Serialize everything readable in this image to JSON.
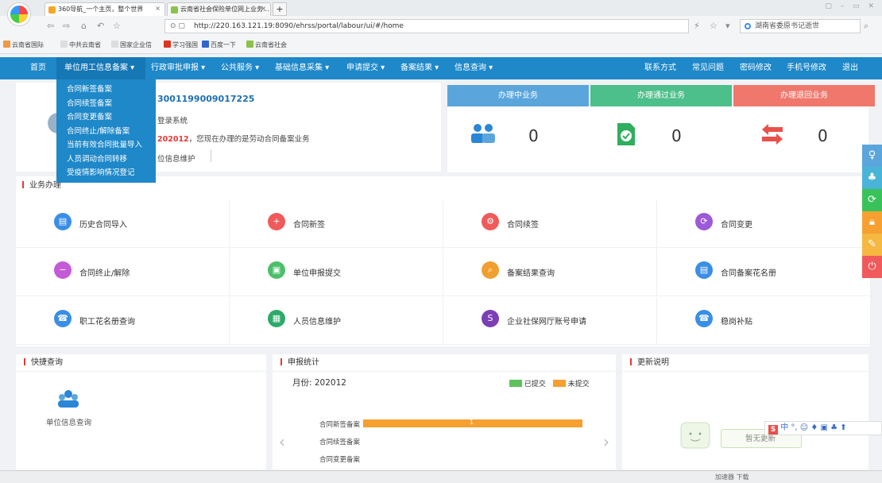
{
  "browser": {
    "tabs": [
      {
        "label": "360导航_一个主页，整个世界",
        "close": "×"
      },
      {
        "label": "云南省社会保险单位网上业务...",
        "close": "×"
      }
    ],
    "new_tab": "+",
    "url": "http://220.163.121.19:8090/ehrss/portal/labour/ui/#/home",
    "search_text": "湖南省委原书记逝世",
    "bookmarks": [
      "云南省国际",
      "中共云南省",
      "国家企业信",
      "学习强国",
      "百度一下",
      "云南省社会"
    ],
    "status_items": "加速器  下载"
  },
  "nav": {
    "items": [
      "首页",
      "单位用工信息备案 ▾",
      "行政审批申报 ▾",
      "公共服务 ▾",
      "基础信息采集 ▾",
      "申请提交 ▾",
      "备案结果 ▾",
      "信息查询 ▾"
    ],
    "right": [
      "联系方式",
      "常见问题",
      "密码修改",
      "手机号修改",
      "退出"
    ]
  },
  "dropdown": [
    "合同新签备案",
    "合同续签备案",
    "合同变更备案",
    "合同终止/解除备案",
    "当前有效合同批量导入",
    "人员调动合同转移",
    "受疫情影响情况登记"
  ],
  "info": {
    "unit_id": "3001199009017225",
    "line1": "登录系统",
    "period_prefix": "",
    "period": "202012",
    "line2": "，您现在办理的是劳动合同备案业务",
    "line3": "位信息维护"
  },
  "stats": [
    {
      "title": "办理中业务",
      "count": "0",
      "color": "#5aa6dc"
    },
    {
      "title": "办理通过业务",
      "count": "0",
      "color": "#4cbf8b"
    },
    {
      "title": "办理退回业务",
      "count": "0",
      "color": "#f0776c"
    }
  ],
  "biz": {
    "title": "业务办理",
    "cells": [
      {
        "label": "历史合同导入",
        "color": "#3a8ee6",
        "glyph": "▤",
        "icon": "import-icon"
      },
      {
        "label": "合同新签",
        "color": "#f05a5a",
        "glyph": "+",
        "icon": "contract-new-icon"
      },
      {
        "label": "合同续签",
        "color": "#f05a5a",
        "glyph": "⚙",
        "icon": "contract-renew-icon"
      },
      {
        "label": "合同变更",
        "color": "#9c5ad8",
        "glyph": "⟳",
        "icon": "contract-change-icon"
      },
      {
        "label": "合同终止/解除",
        "color": "#c45ad8",
        "glyph": "−",
        "icon": "contract-terminate-icon"
      },
      {
        "label": "单位申报提交",
        "color": "#4cbf6b",
        "glyph": "▣",
        "icon": "submit-icon"
      },
      {
        "label": "备案结果查询",
        "color": "#f0a030",
        "glyph": "⌕",
        "icon": "search-icon"
      },
      {
        "label": "合同备案花名册",
        "color": "#3a8ee6",
        "glyph": "▤",
        "icon": "roster-icon"
      },
      {
        "label": "职工花名册查询",
        "color": "#3a8ee6",
        "glyph": "☎",
        "icon": "employee-roster-icon"
      },
      {
        "label": "人员信息维护",
        "color": "#2daa6a",
        "glyph": "▦",
        "icon": "person-info-icon"
      },
      {
        "label": "企业社保网厅账号申请",
        "color": "#7b3fb5",
        "glyph": "S",
        "icon": "account-apply-icon"
      },
      {
        "label": "稳岗补贴",
        "color": "#3a8ee6",
        "glyph": "☎",
        "icon": "subsidy-icon"
      }
    ]
  },
  "quick": {
    "title": "快捷查询",
    "item": "单位信息查询"
  },
  "report": {
    "title": "申报统计",
    "month_label": "月份: 202012",
    "legend": [
      "已提交",
      "未提交"
    ],
    "rows": [
      {
        "label": "合同新签备案",
        "value": "1"
      },
      {
        "label": "合同续签备案",
        "value": ""
      },
      {
        "label": "合同变更备案",
        "value": ""
      }
    ]
  },
  "update": {
    "title": "更新说明",
    "empty": "暂无更新"
  },
  "ime": "中 °, ☺ ♦ ▣ ♣ ⬆"
}
